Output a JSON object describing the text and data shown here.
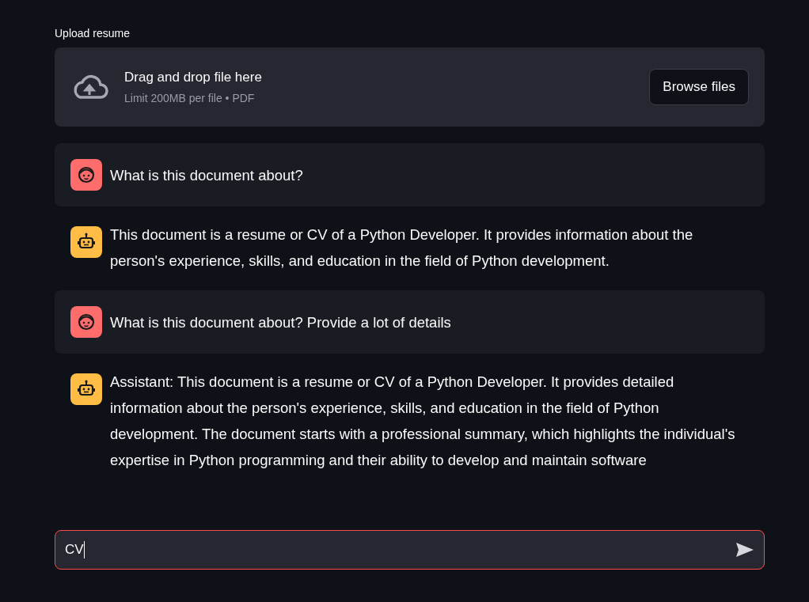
{
  "uploader": {
    "label": "Upload resume",
    "title": "Drag and drop file here",
    "hint": "Limit 200MB per file • PDF",
    "button": "Browse files"
  },
  "messages": [
    {
      "kind": "user",
      "text": "What is this document about?"
    },
    {
      "kind": "assistant",
      "text": "This document is a resume or CV of a Python Developer. It provides information about the person's experience, skills, and education in the field of Python development."
    },
    {
      "kind": "user",
      "text": "What is this document about? Provide a lot of details"
    },
    {
      "kind": "assistant",
      "text": "Assistant: This document is a resume or CV of a Python Developer. It provides detailed information about the person's experience, skills, and education in the field of Python development. The document starts with a professional summary, which highlights the individual's expertise in Python programming and their ability to develop and maintain software"
    }
  ],
  "chat_input": {
    "value": "CV",
    "focused": true
  }
}
